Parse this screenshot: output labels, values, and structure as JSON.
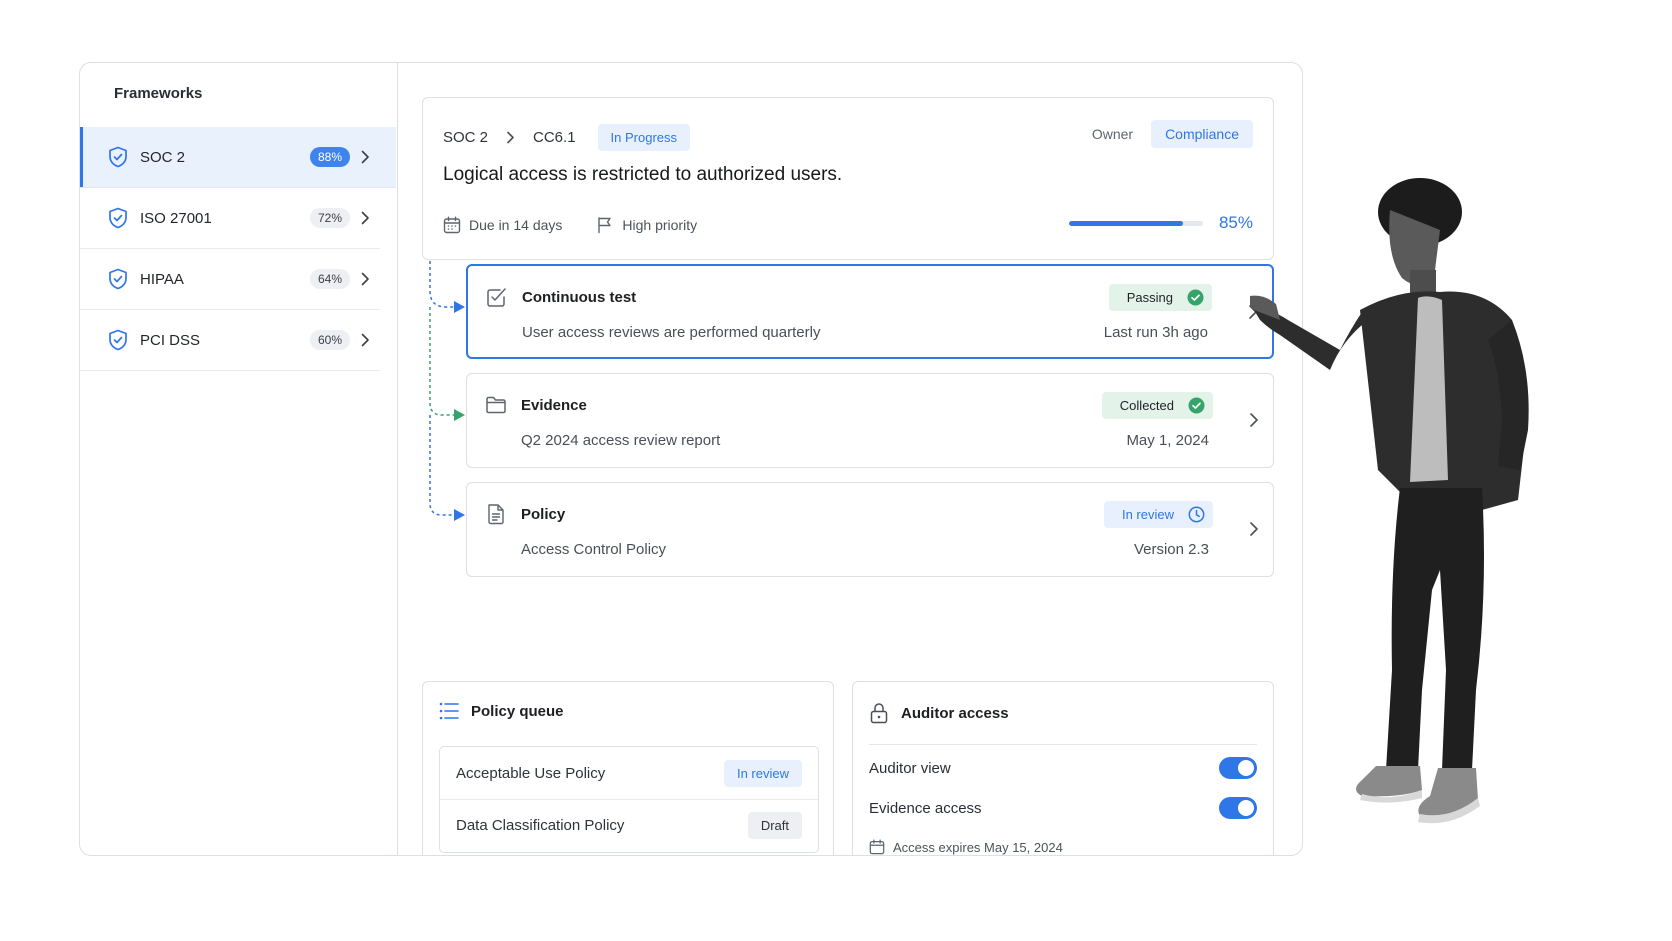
{
  "sidebar": {
    "title": "Frameworks",
    "items": [
      {
        "name": "SOC 2",
        "percent": "88%",
        "active": true
      },
      {
        "name": "ISO 27001",
        "percent": "72%",
        "active": false
      },
      {
        "name": "HIPAA",
        "percent": "64%",
        "active": false
      },
      {
        "name": "PCI DSS",
        "percent": "60%",
        "active": false
      }
    ]
  },
  "header": {
    "breadcrumb": [
      "SOC 2",
      "CC6.1"
    ],
    "status": "In Progress",
    "owner_label": "Owner",
    "owner_value": "Compliance",
    "title": "Logical access is restricted to authorized users.",
    "due": "Due in 14 days",
    "priority": "High priority",
    "progress_percent": "85%",
    "progress_value": 0.85
  },
  "tasks": [
    {
      "icon": "checklist-icon",
      "title": "Continuous test",
      "subtitle": "User access reviews are performed quarterly",
      "badge": "Passing",
      "badge_icon": "check-circle-icon",
      "meta": "Last run 3h ago"
    },
    {
      "icon": "folder-icon",
      "title": "Evidence",
      "subtitle": "Q2 2024 access review report",
      "badge": "Collected",
      "badge_icon": "check-circle-icon",
      "meta": "May 1, 2024"
    },
    {
      "icon": "document-icon",
      "title": "Policy",
      "subtitle": "Access Control Policy",
      "badge": "In review",
      "badge_icon": "clock-icon",
      "meta": "Version 2.3"
    }
  ],
  "policy_queue": {
    "title": "Policy queue",
    "rows": [
      {
        "name": "Acceptable Use Policy",
        "status": "In review"
      },
      {
        "name": "Data Classification Policy",
        "status": "Draft"
      }
    ]
  },
  "auditor_access": {
    "title": "Auditor access",
    "toggles": [
      {
        "label": "Auditor view",
        "on": true
      },
      {
        "label": "Evidence access",
        "on": true
      }
    ],
    "expires": "Access expires May 15, 2024"
  },
  "colors": {
    "accent": "#2f76e6",
    "success": "#36a46a",
    "border": "#dcdfe4"
  }
}
